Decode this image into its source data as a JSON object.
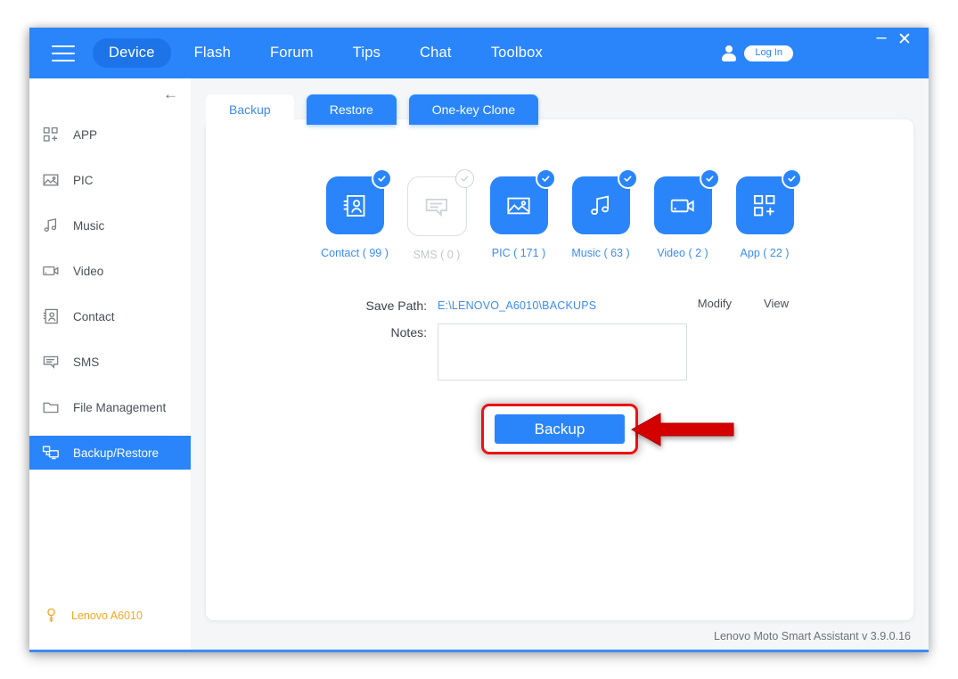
{
  "window": {
    "minimize_label": "–",
    "close_label": "✕"
  },
  "header": {
    "menu_icon": "hamburger-icon",
    "nav": [
      {
        "label": "Device",
        "active": true
      },
      {
        "label": "Flash",
        "active": false
      },
      {
        "label": "Forum",
        "active": false
      },
      {
        "label": "Tips",
        "active": false
      },
      {
        "label": "Chat",
        "active": false
      },
      {
        "label": "Toolbox",
        "active": false
      }
    ],
    "account_icon": "person-icon",
    "login_label": "Log In",
    "background_color": "#2a85fb",
    "active_pill_color": "#1c74e8"
  },
  "sidebar": {
    "collapse_icon": "arrow-left-icon",
    "items": [
      {
        "label": "APP",
        "icon": "apps-grid-icon",
        "active": false
      },
      {
        "label": "PIC",
        "icon": "image-icon",
        "active": false
      },
      {
        "label": "Music",
        "icon": "music-note-icon",
        "active": false
      },
      {
        "label": "Video",
        "icon": "video-camera-icon",
        "active": false
      },
      {
        "label": "Contact",
        "icon": "contact-card-icon",
        "active": false
      },
      {
        "label": "SMS",
        "icon": "message-icon",
        "active": false
      },
      {
        "label": "File Management",
        "icon": "folder-icon",
        "active": false
      },
      {
        "label": "Backup/Restore",
        "icon": "backup-restore-icon",
        "active": true
      }
    ],
    "device": {
      "name": "Lenovo A6010",
      "icon": "usb-plug-icon",
      "color": "#f5a623"
    }
  },
  "content": {
    "tabs": [
      {
        "label": "Backup",
        "active": true
      },
      {
        "label": "Restore",
        "active": false
      },
      {
        "label": "One-key Clone",
        "active": false
      }
    ],
    "categories": [
      {
        "label": "Contact ( 99 )",
        "icon": "contact-card-icon",
        "selected": true,
        "count": 99
      },
      {
        "label": "SMS ( 0 )",
        "icon": "message-icon",
        "selected": false,
        "count": 0
      },
      {
        "label": "PIC ( 171 )",
        "icon": "image-icon",
        "selected": true,
        "count": 171
      },
      {
        "label": "Music ( 63 )",
        "icon": "music-note-icon",
        "selected": true,
        "count": 63
      },
      {
        "label": "Video ( 2 )",
        "icon": "video-camera-icon",
        "selected": true,
        "count": 2
      },
      {
        "label": "App ( 22 )",
        "icon": "apps-grid-icon",
        "selected": true,
        "count": 22
      }
    ],
    "form": {
      "save_path_label": "Save Path:",
      "save_path_value": "E:\\LENOVO_A6010\\BACKUPS",
      "modify_label": "Modify",
      "view_label": "View",
      "notes_label": "Notes:",
      "notes_value": "",
      "notes_placeholder": ""
    },
    "backup_button_label": "Backup",
    "annotation": {
      "highlight_color": "#ee1111",
      "arrow_icon": "left-arrow-annotation"
    },
    "footer_text": "Lenovo Moto Smart Assistant v 3.9.0.16"
  },
  "colors": {
    "accent_blue": "#2a85fb",
    "link_blue": "#3d8bf2",
    "panel_bg": "#f4f6f8",
    "disabled_gray": "#c3c7cd",
    "device_orange": "#f5a623"
  }
}
